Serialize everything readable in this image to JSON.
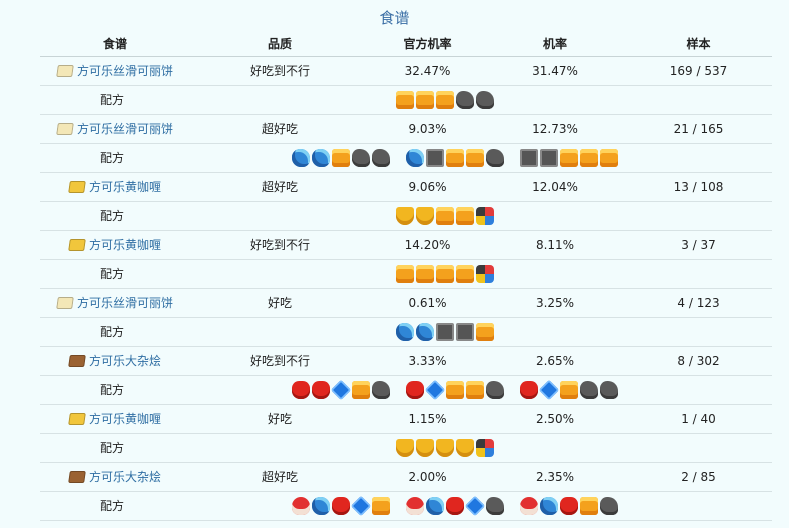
{
  "title": "食谱",
  "headers": [
    "食谱",
    "品质",
    "官方机率",
    "机率",
    "样本"
  ],
  "recipe_label": "配方",
  "rows": [
    {
      "name": "方可乐丝滑可丽饼",
      "icon": "cookie",
      "quality": "好吃到不行",
      "official": "32.47%",
      "rate": "31.47%",
      "sample": "169 / 537",
      "groups": [
        [
          "bread",
          "bread",
          "bread",
          "coal",
          "coal"
        ]
      ]
    },
    {
      "name": "方可乐丝滑可丽饼",
      "icon": "cookie",
      "quality": "超好吃",
      "official": "9.03%",
      "rate": "12.73%",
      "sample": "21 / 165",
      "groups": [
        [
          "ice",
          "ice",
          "bread",
          "coal",
          "coal"
        ],
        [
          "ice",
          "stone",
          "bread",
          "bread",
          "coal"
        ],
        [
          "stone",
          "stone",
          "bread",
          "bread",
          "bread"
        ]
      ]
    },
    {
      "name": "方可乐黄咖喱",
      "icon": "curry",
      "quality": "超好吃",
      "official": "9.06%",
      "rate": "12.04%",
      "sample": "13 / 108",
      "groups": [
        [
          "cup",
          "cup",
          "bread",
          "bread",
          "mix"
        ]
      ]
    },
    {
      "name": "方可乐黄咖喱",
      "icon": "curry",
      "quality": "好吃到不行",
      "official": "14.20%",
      "rate": "8.11%",
      "sample": "3 / 37",
      "groups": [
        [
          "bread",
          "bread",
          "bread",
          "bread",
          "mix"
        ]
      ]
    },
    {
      "name": "方可乐丝滑可丽饼",
      "icon": "cookie",
      "quality": "好吃",
      "official": "0.61%",
      "rate": "3.25%",
      "sample": "4 / 123",
      "groups": [
        [
          "ice",
          "ice",
          "stone",
          "stone",
          "bread"
        ]
      ]
    },
    {
      "name": "方可乐大杂烩",
      "icon": "stew",
      "quality": "好吃到不行",
      "official": "3.33%",
      "rate": "2.65%",
      "sample": "8 / 302",
      "groups": [
        [
          "red",
          "red",
          "blue",
          "bread",
          "coal"
        ],
        [
          "red",
          "blue",
          "bread",
          "bread",
          "coal"
        ],
        [
          "red",
          "blue",
          "bread",
          "coal",
          "coal"
        ]
      ]
    },
    {
      "name": "方可乐黄咖喱",
      "icon": "curry",
      "quality": "好吃",
      "official": "1.15%",
      "rate": "2.50%",
      "sample": "1 / 40",
      "groups": [
        [
          "cup",
          "cup",
          "cup",
          "cup",
          "mix"
        ]
      ]
    },
    {
      "name": "方可乐大杂烩",
      "icon": "stew",
      "quality": "超好吃",
      "official": "2.00%",
      "rate": "2.35%",
      "sample": "2 / 85",
      "groups": [
        [
          "mush",
          "ice",
          "red",
          "blue",
          "bread"
        ],
        [
          "mush",
          "ice",
          "red",
          "blue",
          "coal"
        ],
        [
          "mush",
          "ice",
          "red",
          "bread",
          "coal"
        ]
      ]
    }
  ],
  "icon_names": {
    "cookie": "crepe-icon",
    "curry": "curry-icon",
    "stew": "stew-icon",
    "bread": "bread-icon",
    "coal": "coal-icon",
    "ice": "ice-icon",
    "stone": "stone-icon",
    "cup": "cup-icon",
    "mix": "mixed-ingredient-icon",
    "red": "red-ingredient-icon",
    "blue": "blue-gem-icon",
    "mush": "mushroom-icon"
  }
}
